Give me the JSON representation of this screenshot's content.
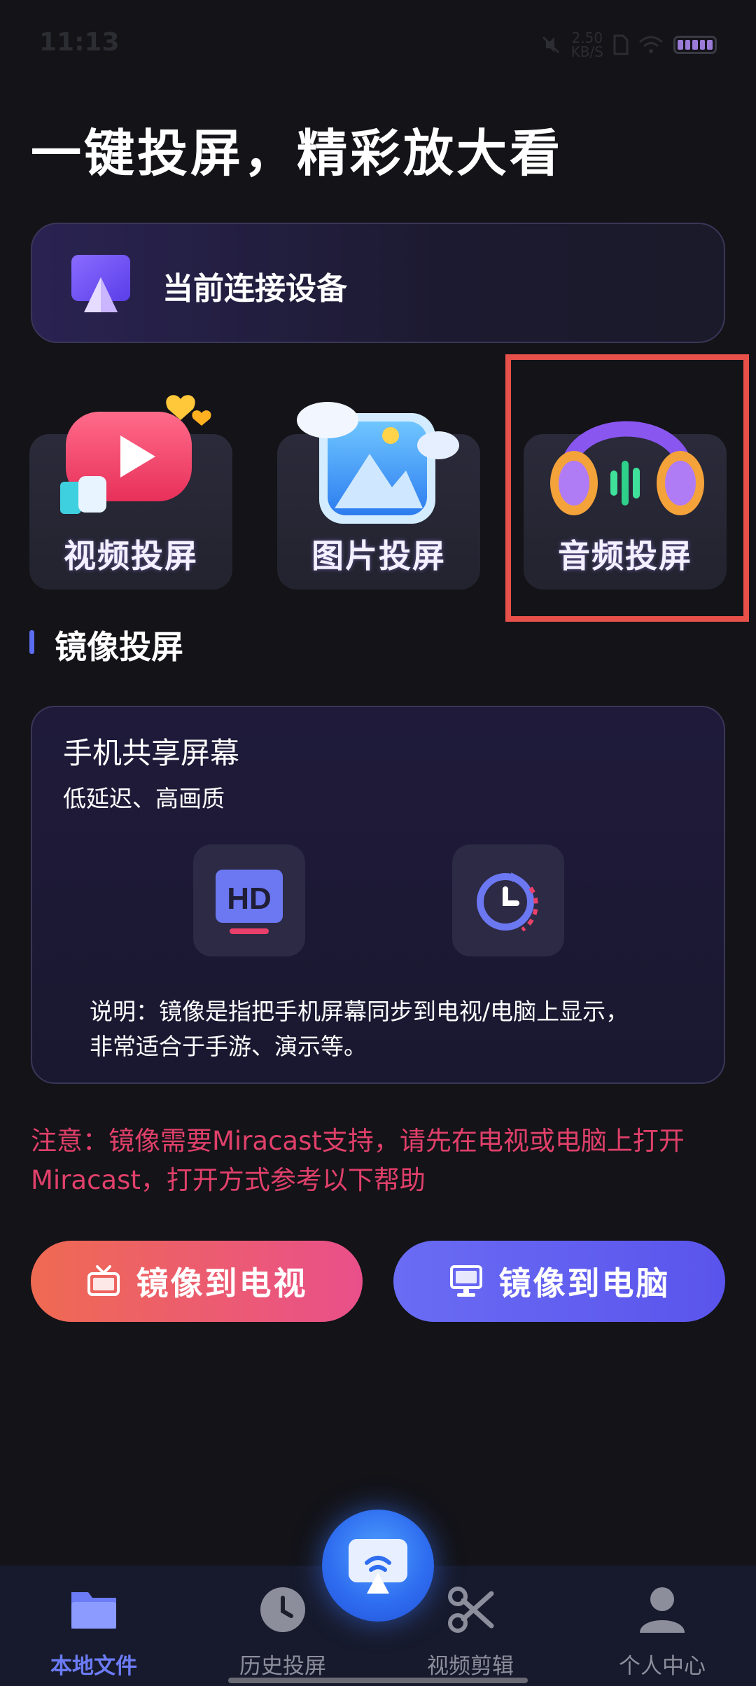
{
  "status_bar": {
    "time": "11:13",
    "speed_value": "2.50",
    "speed_unit": "KB/S"
  },
  "header": {
    "title": "一键投屏，精彩放大看"
  },
  "device_card": {
    "label": "当前连接设备",
    "icon": "cast-device-icon"
  },
  "tiles": [
    {
      "label": "视频投屏",
      "icon": "video-play-icon"
    },
    {
      "label": "图片投屏",
      "icon": "picture-icon"
    },
    {
      "label": "音频投屏",
      "icon": "headphones-icon"
    }
  ],
  "mirror_section": {
    "title": "镜像投屏",
    "card_title": "手机共享屏幕",
    "card_subtitle": "低延迟、高画质",
    "description_line1": "说明：镜像是指把手机屏幕同步到电视/电脑上显示，",
    "description_line2": "非常适合于手游、演示等。",
    "icons": [
      "hd-icon",
      "latency-clock-icon"
    ]
  },
  "notice": {
    "line1": "注意：镜像需要Miracast支持，请先在电视或电脑上打开",
    "line2": "Miracast，打开方式参考以下帮助"
  },
  "actions": {
    "tv_label": "镜像到电视",
    "pc_label": "镜像到电脑"
  },
  "bottom_nav": {
    "items": [
      {
        "label": "本地文件",
        "icon": "folder-icon",
        "active": true
      },
      {
        "label": "历史投屏",
        "icon": "clock-icon",
        "active": false
      },
      {
        "label": "视频剪辑",
        "icon": "scissors-icon",
        "active": false
      },
      {
        "label": "个人中心",
        "icon": "person-icon",
        "active": false
      }
    ],
    "center_button_icon": "cast-icon"
  },
  "colors": {
    "background": "#131318",
    "accent": "#6c7cf6",
    "notice": "#e0406a",
    "highlight": "#e8504a"
  }
}
